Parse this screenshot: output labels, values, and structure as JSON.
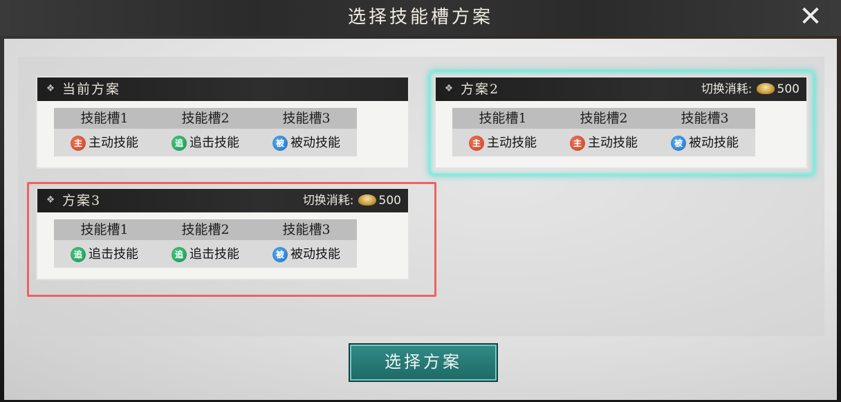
{
  "window": {
    "title": "选择技能槽方案",
    "close_icon": "close-x-icon"
  },
  "plans": [
    {
      "name": "当前方案",
      "has_cost": false,
      "headers": [
        "技能槽1",
        "技能槽2",
        "技能槽3"
      ],
      "slots": [
        {
          "badge": "主",
          "type": "active",
          "label": "主动技能"
        },
        {
          "badge": "追",
          "type": "chase",
          "label": "追击技能"
        },
        {
          "badge": "被",
          "type": "passive",
          "label": "被动技能"
        }
      ]
    },
    {
      "name": "方案2",
      "has_cost": true,
      "cost_label": "切换消耗:",
      "cost_value": "500",
      "highlight": "selected",
      "headers": [
        "技能槽1",
        "技能槽2",
        "技能槽3"
      ],
      "slots": [
        {
          "badge": "主",
          "type": "active",
          "label": "主动技能"
        },
        {
          "badge": "主",
          "type": "active",
          "label": "主动技能"
        },
        {
          "badge": "被",
          "type": "passive",
          "label": "被动技能"
        }
      ]
    },
    {
      "name": "方案3",
      "has_cost": true,
      "cost_label": "切换消耗:",
      "cost_value": "500",
      "highlight": "red-outline",
      "headers": [
        "技能槽1",
        "技能槽2",
        "技能槽3"
      ],
      "slots": [
        {
          "badge": "追",
          "type": "chase",
          "label": "追击技能"
        },
        {
          "badge": "追",
          "type": "chase",
          "label": "追击技能"
        },
        {
          "badge": "被",
          "type": "passive",
          "label": "被动技能"
        }
      ]
    }
  ],
  "confirm_button": {
    "label": "选择方案"
  },
  "colors": {
    "accent": "#2f8a86",
    "selected_glow": "#7ef0e0",
    "red_outline": "#f06060"
  }
}
